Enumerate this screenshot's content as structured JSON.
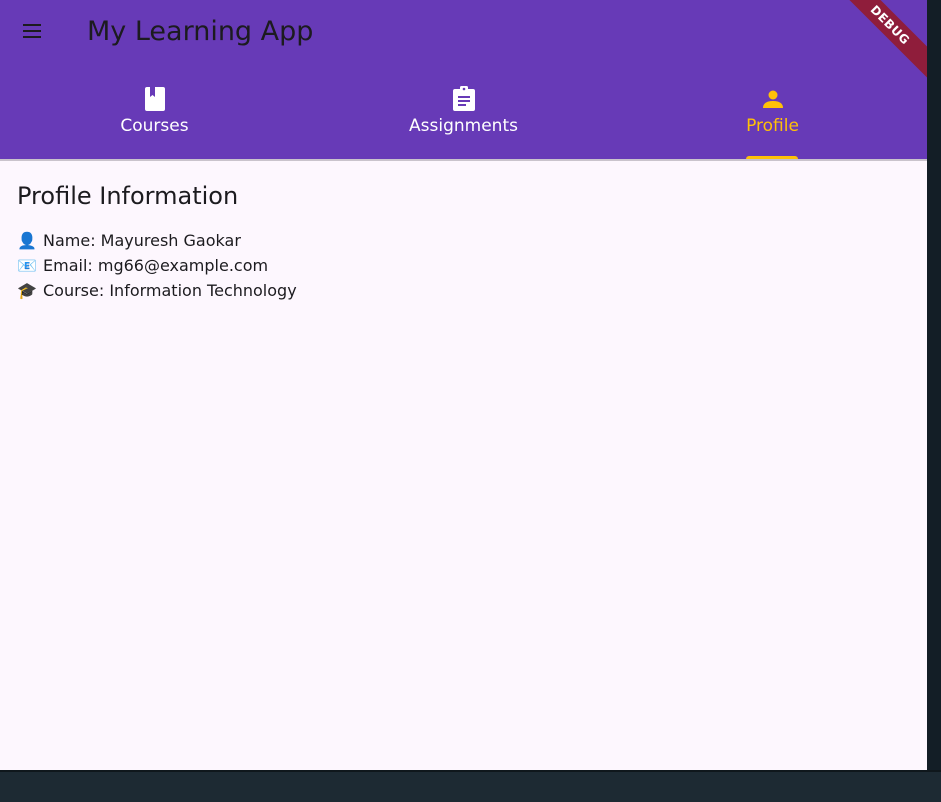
{
  "appbar": {
    "title": "My Learning App",
    "menu_icon": "hamburger-menu-icon"
  },
  "tabs": [
    {
      "label": "Courses",
      "icon": "book-icon",
      "selected": false
    },
    {
      "label": "Assignments",
      "icon": "clipboard-icon",
      "selected": false
    },
    {
      "label": "Profile",
      "icon": "person-icon",
      "selected": true
    }
  ],
  "debug_banner": "DEBUG",
  "profile": {
    "heading": "Profile Information",
    "name": {
      "icon": "👤",
      "text": "Name: Mayuresh Gaokar"
    },
    "email": {
      "icon": "📧",
      "text": "Email: mg66@example.com"
    },
    "course": {
      "icon": "🎓",
      "text": "Course: Information Technology"
    }
  },
  "colors": {
    "primary": "#673ab7",
    "accent": "#ffc107",
    "background": "#fdf7fe",
    "text": "#1c1b1f"
  }
}
